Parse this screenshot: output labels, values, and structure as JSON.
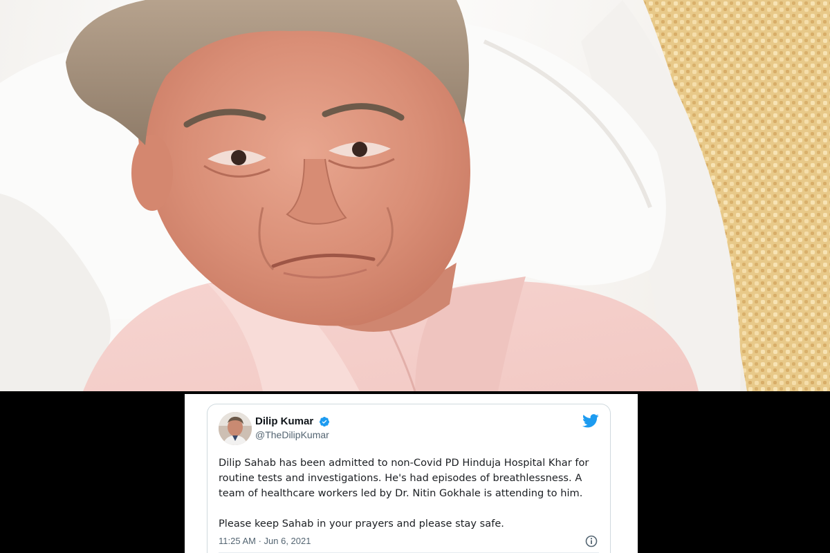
{
  "photo": {
    "description_icon": "portrait-photo"
  },
  "tweet": {
    "author_name": "Dilip Kumar",
    "author_handle": "@TheDilipKumar",
    "verified": true,
    "body": "Dilip Sahab has been admitted to non-Covid PD Hinduja Hospital Khar for routine tests and investigations. He's had episodes of breathlessness. A team of healthcare workers led by Dr. Nitin Gokhale is attending to him.\n\nPlease keep Sahab in your prayers and please stay safe.",
    "timestamp": "11:25 AM · Jun 6, 2021",
    "colors": {
      "twitter_blue": "#1d9bf0",
      "text": "#0f1419",
      "secondary": "#536471"
    },
    "icons": [
      "twitter-bird-icon",
      "verified-badge-icon",
      "info-icon"
    ]
  }
}
